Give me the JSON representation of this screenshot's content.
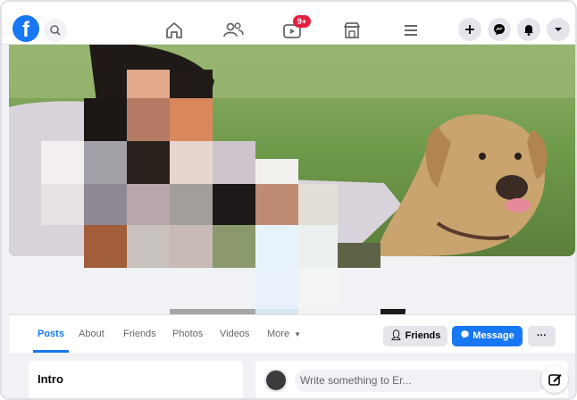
{
  "nav": {
    "logo_glyph": "f",
    "icons": [
      "search-icon",
      "home-icon",
      "friends-icon",
      "watch-icon",
      "marketplace-icon",
      "menu-icon",
      "create-icon",
      "messenger-icon",
      "notifications-icon",
      "account-caret-icon"
    ],
    "watch_badge": "9+"
  },
  "profile_tabs": {
    "posts": "Posts",
    "about": "About",
    "friends": "Friends",
    "photos": "Photos",
    "videos": "Videos",
    "more": "More"
  },
  "actions": {
    "friends_label": "Friends",
    "message_label": "Message",
    "more_label": "···"
  },
  "intro": {
    "title": "Intro"
  },
  "composer": {
    "placeholder": "Write something to Er..."
  },
  "colors": {
    "brand_blue": "#1877f2",
    "badge_red": "#e41e3f",
    "page_bg": "#f0f2f5"
  }
}
